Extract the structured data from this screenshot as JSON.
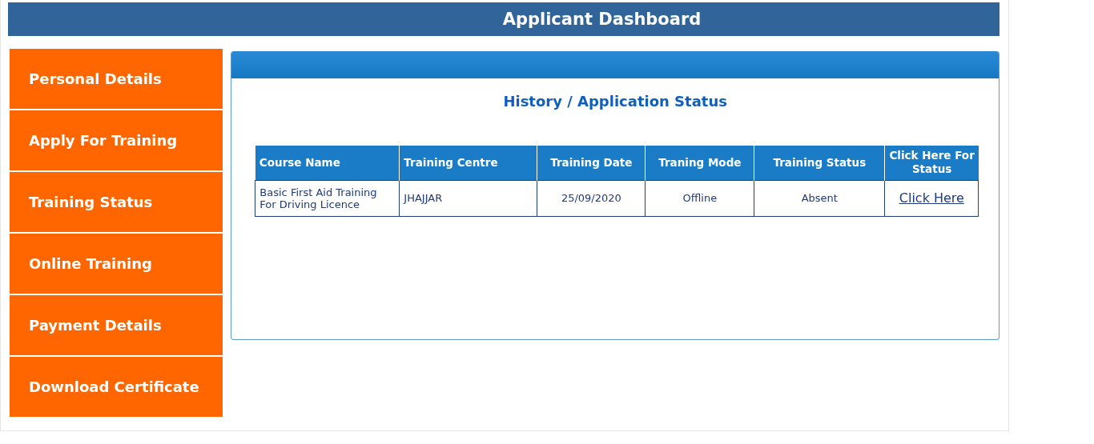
{
  "header": {
    "title": "Applicant Dashboard"
  },
  "sidebar": {
    "items": [
      {
        "label": "Personal Details"
      },
      {
        "label": "Apply For Training"
      },
      {
        "label": "Training Status"
      },
      {
        "label": "Online Training"
      },
      {
        "label": "Payment Details"
      },
      {
        "label": "Download Certificate"
      }
    ]
  },
  "panel": {
    "title": "History / Application Status"
  },
  "table": {
    "columns": [
      "Course Name",
      "Training Centre",
      "Training Date",
      "Traning Mode",
      "Training Status",
      "Click Here For Status"
    ],
    "rows": [
      {
        "cells": [
          "Basic First Aid Training For Driving Licence",
          "JHAJJAR",
          "25/09/2020",
          "Offline",
          "Absent"
        ],
        "link": "Click Here"
      }
    ]
  }
}
